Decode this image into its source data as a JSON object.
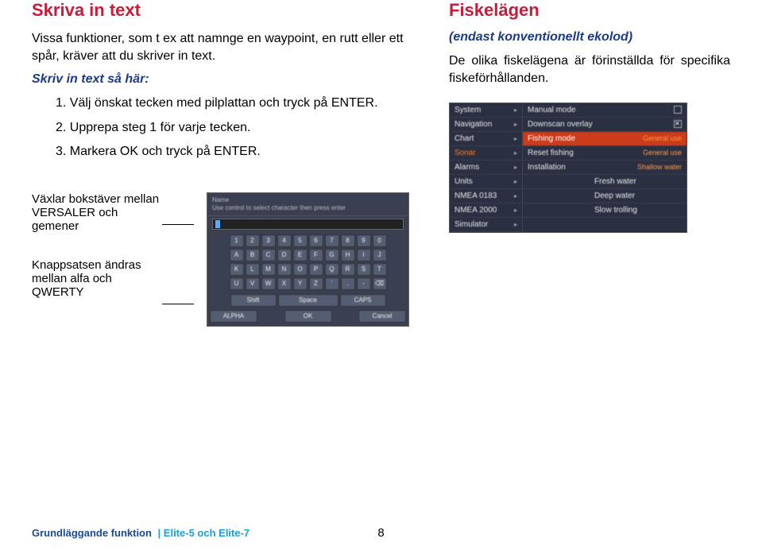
{
  "left": {
    "heading": "Skriva in text",
    "intro": "Vissa funktioner, som t ex att namnge en waypoint, en rutt eller ett spår, kräver att du skriver in text.",
    "subhead": "Skriv in text så här:",
    "steps": [
      "1.   Välj önskat tecken med pilplattan och tryck på ENTER.",
      "2.   Upprepa steg 1 för varje tecken.",
      "3.   Markera OK och tryck på ENTER."
    ],
    "label1": "Växlar bokstäver mellan VERSALER och gemener",
    "label2": "Knappsatsen ändras mellan alfa och QWERTY"
  },
  "right": {
    "heading": "Fiskelägen",
    "subhead": "(endast konventionellt ekolod)",
    "body": "De olika fiskelägena är förinställda för specifika fiskeförhållanden."
  },
  "menu": {
    "col1": [
      "System",
      "Navigation",
      "Chart",
      "Sonar",
      "Alarms",
      "Units",
      "NMEA 0183",
      "NMEA 2000",
      "Simulator"
    ],
    "col2": [
      {
        "label": "Manual mode",
        "type": "cb",
        "checked": false
      },
      {
        "label": "Downscan overlay",
        "type": "cb",
        "checked": true
      },
      {
        "label": "Fishing mode",
        "type": "sel",
        "value": "General use"
      },
      {
        "label": "Reset fishing",
        "type": "sub",
        "value": "General use"
      },
      {
        "label": "Installation",
        "type": "sub",
        "value": "Shallow water"
      },
      {
        "label": "",
        "type": "plain",
        "value": "Fresh water"
      },
      {
        "label": "",
        "type": "plain",
        "value": "Deep water"
      },
      {
        "label": "",
        "type": "plain",
        "value": "Slow trolling"
      }
    ]
  },
  "keyboard": {
    "top1": "Name",
    "top2": "Use control to select character then press enter",
    "rows": [
      [
        "1",
        "2",
        "3",
        "4",
        "5",
        "6",
        "7",
        "8",
        "9",
        "0"
      ],
      [
        "A",
        "B",
        "C",
        "D",
        "E",
        "F",
        "G",
        "H",
        "I",
        "J"
      ],
      [
        "K",
        "L",
        "M",
        "N",
        "O",
        "P",
        "Q",
        "R",
        "S",
        "T"
      ],
      [
        "U",
        "V",
        "W",
        "X",
        "Y",
        "Z",
        "'",
        ".",
        "-",
        "⌫"
      ]
    ],
    "specialRow": [
      "Shift",
      "Space",
      "CAPS"
    ],
    "bottom": [
      "ALPHA",
      "OK",
      "Cancel"
    ]
  },
  "footer": {
    "section": "Grundläggande funktion",
    "model": " | Elite-5 och Elite-7",
    "page": "8"
  }
}
